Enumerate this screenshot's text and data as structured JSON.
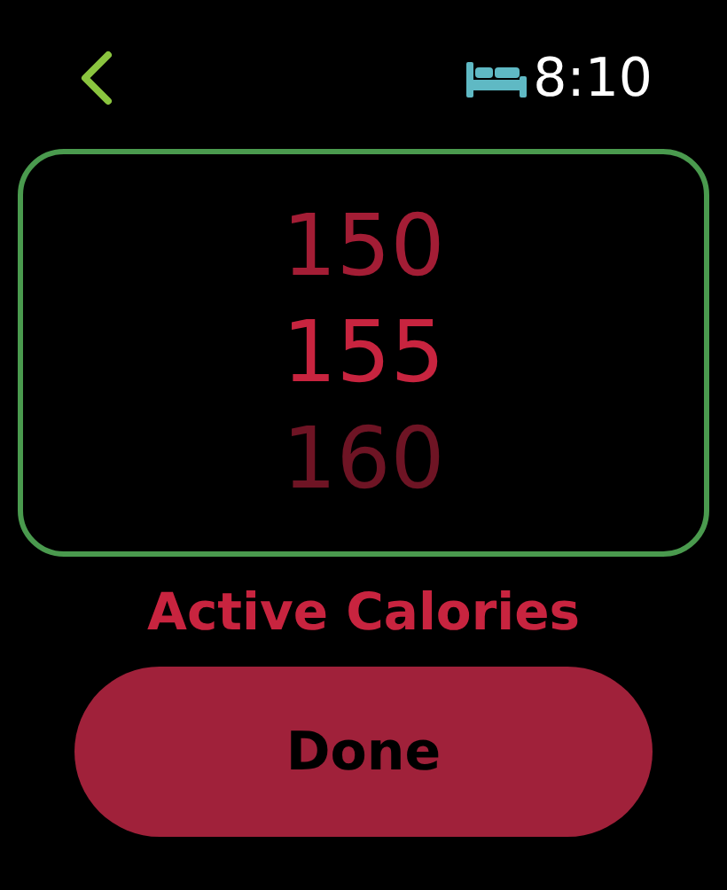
{
  "status_bar": {
    "time": "8:10",
    "sleep_mode": true
  },
  "picker": {
    "values": [
      {
        "label": "150",
        "selected": false
      },
      {
        "label": "155",
        "selected": true
      },
      {
        "label": "160",
        "selected": false
      }
    ]
  },
  "title": "Active Calories",
  "buttons": [
    {
      "label": "Done"
    }
  ]
}
